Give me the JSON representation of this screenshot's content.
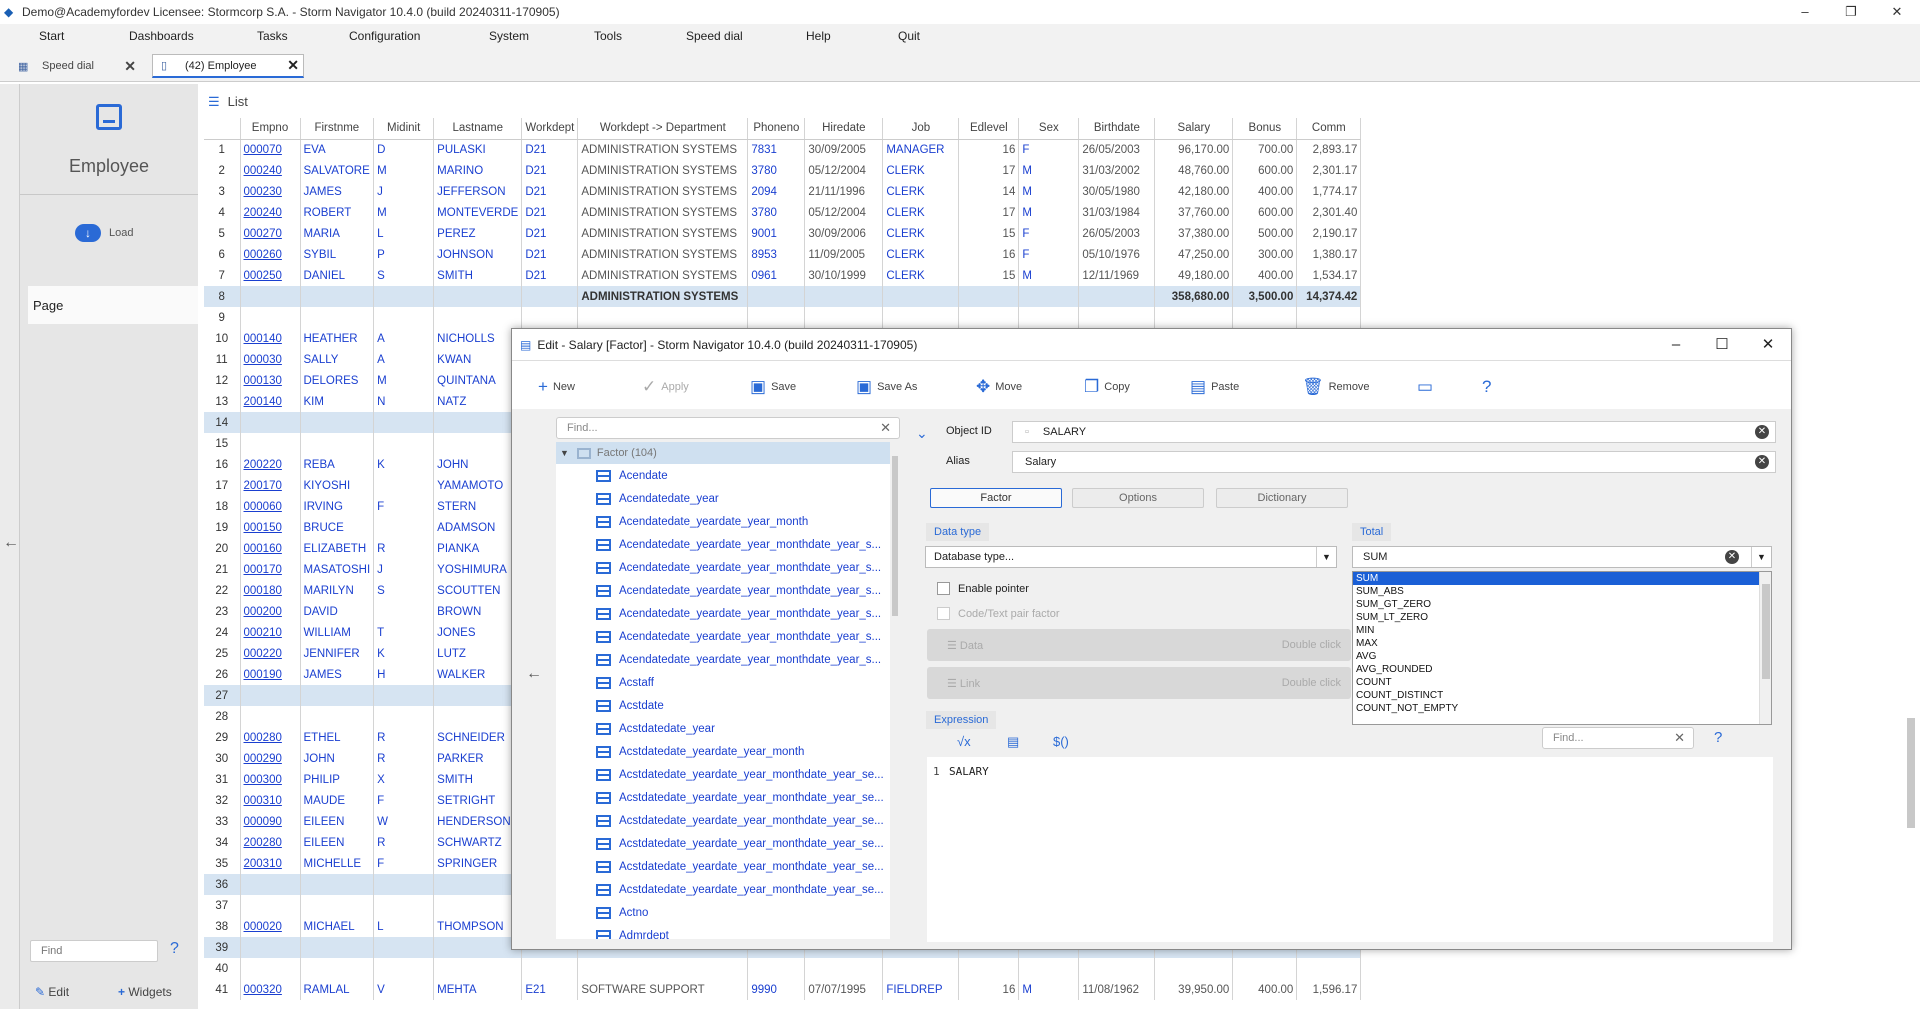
{
  "window": {
    "title": "Demo@Academyfordev   Licensee: Stormcorp S.A. -  Storm Navigator 10.4.0 (build 20240311-170905)"
  },
  "menu": [
    "Start",
    "Dashboards",
    "Tasks",
    "Configuration",
    "System",
    "Tools",
    "Speed dial",
    "Help",
    "Quit"
  ],
  "tabs": [
    {
      "label": "Speed dial"
    },
    {
      "label": "(42) Employee"
    }
  ],
  "sidebar": {
    "title": "Employee",
    "load": "Load",
    "page": "Page",
    "find_placeholder": "Find",
    "edit": "Edit",
    "widgets": "Widgets"
  },
  "list": {
    "title": "List",
    "columns": [
      "Empno",
      "Firstnme",
      "Midinit",
      "Lastname",
      "Workdept",
      "Workdept -> Department",
      "Phoneno",
      "Hiredate",
      "Job",
      "Edlevel",
      "Sex",
      "Birthdate",
      "Salary",
      "Bonus",
      "Comm"
    ],
    "rows": [
      {
        "n": "1",
        "c": [
          "000070",
          "EVA",
          "D",
          "PULASKI",
          "D21",
          "ADMINISTRATION SYSTEMS",
          "7831",
          "30/09/2005",
          "MANAGER",
          "16",
          "F",
          "26/05/2003",
          "96,170.00",
          "700.00",
          "2,893.17"
        ]
      },
      {
        "n": "2",
        "c": [
          "000240",
          "SALVATORE",
          "M",
          "MARINO",
          "D21",
          "ADMINISTRATION SYSTEMS",
          "3780",
          "05/12/2004",
          "CLERK",
          "17",
          "M",
          "31/03/2002",
          "48,760.00",
          "600.00",
          "2,301.17"
        ]
      },
      {
        "n": "3",
        "c": [
          "000230",
          "JAMES",
          "J",
          "JEFFERSON",
          "D21",
          "ADMINISTRATION SYSTEMS",
          "2094",
          "21/11/1996",
          "CLERK",
          "14",
          "M",
          "30/05/1980",
          "42,180.00",
          "400.00",
          "1,774.17"
        ]
      },
      {
        "n": "4",
        "c": [
          "200240",
          "ROBERT",
          "M",
          "MONTEVERDE",
          "D21",
          "ADMINISTRATION SYSTEMS",
          "3780",
          "05/12/2004",
          "CLERK",
          "17",
          "M",
          "31/03/1984",
          "37,760.00",
          "600.00",
          "2,301.40"
        ]
      },
      {
        "n": "5",
        "c": [
          "000270",
          "MARIA",
          "L",
          "PEREZ",
          "D21",
          "ADMINISTRATION SYSTEMS",
          "9001",
          "30/09/2006",
          "CLERK",
          "15",
          "F",
          "26/05/2003",
          "37,380.00",
          "500.00",
          "2,190.17"
        ]
      },
      {
        "n": "6",
        "c": [
          "000260",
          "SYBIL",
          "P",
          "JOHNSON",
          "D21",
          "ADMINISTRATION SYSTEMS",
          "8953",
          "11/09/2005",
          "CLERK",
          "16",
          "F",
          "05/10/1976",
          "47,250.00",
          "300.00",
          "1,380.17"
        ]
      },
      {
        "n": "7",
        "c": [
          "000250",
          "DANIEL",
          "S",
          "SMITH",
          "D21",
          "ADMINISTRATION SYSTEMS",
          "0961",
          "30/10/1999",
          "CLERK",
          "15",
          "M",
          "12/11/1969",
          "49,180.00",
          "400.00",
          "1,534.17"
        ]
      },
      {
        "n": "8",
        "sub": true,
        "c": [
          "",
          "",
          "",
          "",
          "",
          "ADMINISTRATION SYSTEMS",
          "",
          "",
          "",
          "",
          "",
          "",
          "358,680.00",
          "3,500.00",
          "14,374.42"
        ]
      },
      {
        "n": "9",
        "c": [
          "",
          "",
          "",
          "",
          "",
          "",
          "",
          "",
          "",
          "",
          "",
          "",
          "",
          "",
          ""
        ]
      },
      {
        "n": "10",
        "c": [
          "000140",
          "HEATHER",
          "A",
          "NICHOLLS",
          "",
          "",
          "",
          "",
          "",
          "",
          "",
          "",
          "",
          "",
          ""
        ]
      },
      {
        "n": "11",
        "c": [
          "000030",
          "SALLY",
          "A",
          "KWAN",
          "",
          "",
          "",
          "",
          "",
          "",
          "",
          "",
          "",
          "",
          ""
        ]
      },
      {
        "n": "12",
        "c": [
          "000130",
          "DELORES",
          "M",
          "QUINTANA",
          "",
          "",
          "",
          "",
          "",
          "",
          "",
          "",
          "",
          "",
          ""
        ]
      },
      {
        "n": "13",
        "c": [
          "200140",
          "KIM",
          "N",
          "NATZ",
          "",
          "",
          "",
          "",
          "",
          "",
          "",
          "",
          "",
          "",
          ""
        ]
      },
      {
        "n": "14",
        "sub": true,
        "c": [
          "",
          "",
          "",
          "",
          "",
          "",
          "",
          "",
          "",
          "",
          "",
          "",
          "",
          "",
          ""
        ]
      },
      {
        "n": "15",
        "c": [
          "",
          "",
          "",
          "",
          "",
          "",
          "",
          "",
          "",
          "",
          "",
          "",
          "",
          "",
          ""
        ]
      },
      {
        "n": "16",
        "c": [
          "200220",
          "REBA",
          "K",
          "JOHN",
          "",
          "",
          "",
          "",
          "",
          "",
          "",
          "",
          "",
          "",
          ""
        ]
      },
      {
        "n": "17",
        "c": [
          "200170",
          "KIYOSHI",
          "",
          "YAMAMOTO",
          "",
          "",
          "",
          "",
          "",
          "",
          "",
          "",
          "",
          "",
          ""
        ]
      },
      {
        "n": "18",
        "c": [
          "000060",
          "IRVING",
          "F",
          "STERN",
          "",
          "",
          "",
          "",
          "",
          "",
          "",
          "",
          "",
          "",
          ""
        ]
      },
      {
        "n": "19",
        "c": [
          "000150",
          "BRUCE",
          "",
          "ADAMSON",
          "",
          "",
          "",
          "",
          "",
          "",
          "",
          "",
          "",
          "",
          ""
        ]
      },
      {
        "n": "20",
        "c": [
          "000160",
          "ELIZABETH",
          "R",
          "PIANKA",
          "",
          "",
          "",
          "",
          "",
          "",
          "",
          "",
          "",
          "",
          ""
        ]
      },
      {
        "n": "21",
        "c": [
          "000170",
          "MASATOSHI",
          "J",
          "YOSHIMURA",
          "",
          "",
          "",
          "",
          "",
          "",
          "",
          "",
          "",
          "",
          ""
        ]
      },
      {
        "n": "22",
        "c": [
          "000180",
          "MARILYN",
          "S",
          "SCOUTTEN",
          "",
          "",
          "",
          "",
          "",
          "",
          "",
          "",
          "",
          "",
          ""
        ]
      },
      {
        "n": "23",
        "c": [
          "000200",
          "DAVID",
          "",
          "BROWN",
          "",
          "",
          "",
          "",
          "",
          "",
          "",
          "",
          "",
          "",
          ""
        ]
      },
      {
        "n": "24",
        "c": [
          "000210",
          "WILLIAM",
          "T",
          "JONES",
          "",
          "",
          "",
          "",
          "",
          "",
          "",
          "",
          "",
          "",
          ""
        ]
      },
      {
        "n": "25",
        "c": [
          "000220",
          "JENNIFER",
          "K",
          "LUTZ",
          "",
          "",
          "",
          "",
          "",
          "",
          "",
          "",
          "",
          "",
          ""
        ]
      },
      {
        "n": "26",
        "c": [
          "000190",
          "JAMES",
          "H",
          "WALKER",
          "",
          "",
          "",
          "",
          "",
          "",
          "",
          "",
          "",
          "",
          ""
        ]
      },
      {
        "n": "27",
        "sub": true,
        "c": [
          "",
          "",
          "",
          "",
          "",
          "",
          "",
          "",
          "",
          "",
          "",
          "",
          "",
          "",
          ""
        ]
      },
      {
        "n": "28",
        "c": [
          "",
          "",
          "",
          "",
          "",
          "",
          "",
          "",
          "",
          "",
          "",
          "",
          "",
          "",
          ""
        ]
      },
      {
        "n": "29",
        "c": [
          "000280",
          "ETHEL",
          "R",
          "SCHNEIDER",
          "",
          "",
          "",
          "",
          "",
          "",
          "",
          "",
          "",
          "",
          ""
        ]
      },
      {
        "n": "30",
        "c": [
          "000290",
          "JOHN",
          "R",
          "PARKER",
          "",
          "",
          "",
          "",
          "",
          "",
          "",
          "",
          "",
          "",
          ""
        ]
      },
      {
        "n": "31",
        "c": [
          "000300",
          "PHILIP",
          "X",
          "SMITH",
          "",
          "",
          "",
          "",
          "",
          "",
          "",
          "",
          "",
          "",
          ""
        ]
      },
      {
        "n": "32",
        "c": [
          "000310",
          "MAUDE",
          "F",
          "SETRIGHT",
          "",
          "",
          "",
          "",
          "",
          "",
          "",
          "",
          "",
          "",
          ""
        ]
      },
      {
        "n": "33",
        "c": [
          "000090",
          "EILEEN",
          "W",
          "HENDERSON",
          "",
          "",
          "",
          "",
          "",
          "",
          "",
          "",
          "",
          "",
          ""
        ]
      },
      {
        "n": "34",
        "c": [
          "200280",
          "EILEEN",
          "R",
          "SCHWARTZ",
          "",
          "",
          "",
          "",
          "",
          "",
          "",
          "",
          "",
          "",
          ""
        ]
      },
      {
        "n": "35",
        "c": [
          "200310",
          "MICHELLE",
          "F",
          "SPRINGER",
          "",
          "",
          "",
          "",
          "",
          "",
          "",
          "",
          "",
          "",
          ""
        ]
      },
      {
        "n": "36",
        "sub": true,
        "c": [
          "",
          "",
          "",
          "",
          "",
          "",
          "",
          "",
          "",
          "",
          "",
          "",
          "",
          "",
          ""
        ]
      },
      {
        "n": "37",
        "c": [
          "",
          "",
          "",
          "",
          "",
          "",
          "",
          "",
          "",
          "",
          "",
          "",
          "",
          "",
          ""
        ]
      },
      {
        "n": "38",
        "c": [
          "000020",
          "MICHAEL",
          "L",
          "THOMPSON",
          "",
          "",
          "",
          "",
          "",
          "",
          "",
          "",
          "",
          "",
          ""
        ]
      },
      {
        "n": "39",
        "sub": true,
        "c": [
          "",
          "",
          "",
          "",
          "",
          "",
          "",
          "",
          "",
          "",
          "",
          "",
          "",
          "",
          ""
        ]
      },
      {
        "n": "40",
        "c": [
          "",
          "",
          "",
          "",
          "",
          "",
          "",
          "",
          "",
          "",
          "",
          "",
          "",
          "",
          ""
        ]
      },
      {
        "n": "41",
        "c": [
          "000320",
          "RAMLAL",
          "V",
          "MEHTA",
          "E21",
          "SOFTWARE SUPPORT",
          "9990",
          "07/07/1995",
          "FIELDREP",
          "16",
          "M",
          "11/08/1962",
          "39,950.00",
          "400.00",
          "1,596.17"
        ]
      }
    ]
  },
  "dialog": {
    "title": "Edit - Salary [Factor] -  Storm Navigator 10.4.0 (build 20240311-170905)",
    "toolbar": [
      "New",
      "Apply",
      "Save",
      "Save As",
      "Move",
      "Copy",
      "Paste",
      "Remove"
    ],
    "tree_find": "Find...",
    "tree_root": "Factor (104)",
    "tree_items": [
      "Acendate",
      "Acendatedate_year",
      "Acendatedate_yeardate_year_month",
      "Acendatedate_yeardate_year_monthdate_year_s...",
      "Acendatedate_yeardate_year_monthdate_year_s...",
      "Acendatedate_yeardate_year_monthdate_year_s...",
      "Acendatedate_yeardate_year_monthdate_year_s...",
      "Acendatedate_yeardate_year_monthdate_year_s...",
      "Acendatedate_yeardate_year_monthdate_year_s...",
      "Acstaff",
      "Acstdate",
      "Acstdatedate_year",
      "Acstdatedate_yeardate_year_month",
      "Acstdatedate_yeardate_year_monthdate_year_se...",
      "Acstdatedate_yeardate_year_monthdate_year_se...",
      "Acstdatedate_yeardate_year_monthdate_year_se...",
      "Acstdatedate_yeardate_year_monthdate_year_se...",
      "Acstdatedate_yeardate_year_monthdate_year_se...",
      "Acstdatedate_yeardate_year_monthdate_year_se...",
      "Actno",
      "Admrdept"
    ],
    "object_id_label": "Object ID",
    "object_id": "SALARY",
    "alias_label": "Alias",
    "alias": "Salary",
    "tabs": [
      "Factor",
      "Options",
      "Dictionary"
    ],
    "data_type_label": "Data type",
    "data_type": "Database type...",
    "enable_pointer": "Enable pointer",
    "code_text": "Code/Text pair factor",
    "data_label": "Data",
    "link_label": "Link",
    "double_click": "Double click",
    "total_label": "Total",
    "total_value": "SUM",
    "total_options": [
      "SUM",
      "SUM_ABS",
      "SUM_GT_ZERO",
      "SUM_LT_ZERO",
      "MIN",
      "MAX",
      "AVG",
      "AVG_ROUNDED",
      "COUNT",
      "COUNT_DISTINCT",
      "COUNT_NOT_EMPTY"
    ],
    "expression_label": "Expression",
    "expr_find": "Find...",
    "line_no": "1",
    "expression": "SALARY"
  }
}
